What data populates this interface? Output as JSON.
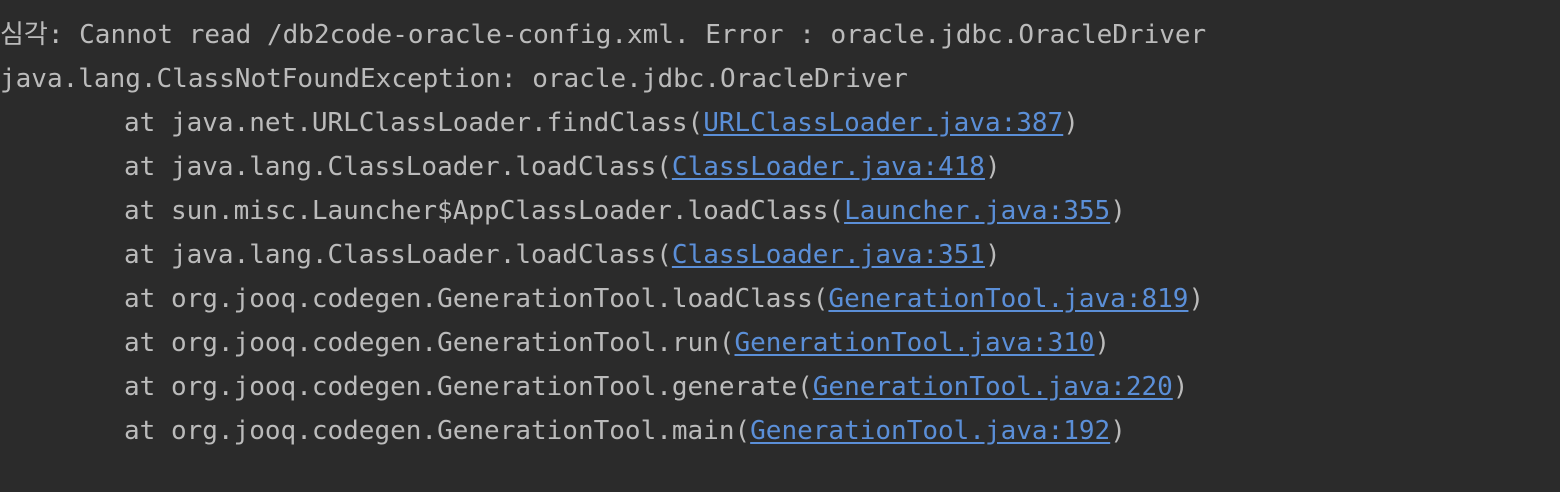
{
  "console": {
    "cut_line": "",
    "error_line": "심각: Cannot read /db2code-oracle-config.xml. Error : oracle.jdbc.OracleDriver",
    "exception": "java.lang.ClassNotFoundException: oracle.jdbc.OracleDriver",
    "frames": [
      {
        "prefix": "at ",
        "method": "java.net.URLClassLoader.findClass",
        "open": "(",
        "link": "URLClassLoader.java:387",
        "close": ")"
      },
      {
        "prefix": "at ",
        "method": "java.lang.ClassLoader.loadClass",
        "open": "(",
        "link": "ClassLoader.java:418",
        "close": ")"
      },
      {
        "prefix": "at ",
        "method": "sun.misc.Launcher$AppClassLoader.loadClass",
        "open": "(",
        "link": "Launcher.java:355",
        "close": ")"
      },
      {
        "prefix": "at ",
        "method": "java.lang.ClassLoader.loadClass",
        "open": "(",
        "link": "ClassLoader.java:351",
        "close": ")"
      },
      {
        "prefix": "at ",
        "method": "org.jooq.codegen.GenerationTool.loadClass",
        "open": "(",
        "link": "GenerationTool.java:819",
        "close": ")"
      },
      {
        "prefix": "at ",
        "method": "org.jooq.codegen.GenerationTool.run",
        "open": "(",
        "link": "GenerationTool.java:310",
        "close": ")"
      },
      {
        "prefix": "at ",
        "method": "org.jooq.codegen.GenerationTool.generate",
        "open": "(",
        "link": "GenerationTool.java:220",
        "close": ")"
      },
      {
        "prefix": "at ",
        "method": "org.jooq.codegen.GenerationTool.main",
        "open": "(",
        "link": "GenerationTool.java:192",
        "close": ")"
      }
    ]
  },
  "colors": {
    "background": "#2b2b2b",
    "text": "#bbbbbb",
    "link": "#5b8fd8"
  }
}
